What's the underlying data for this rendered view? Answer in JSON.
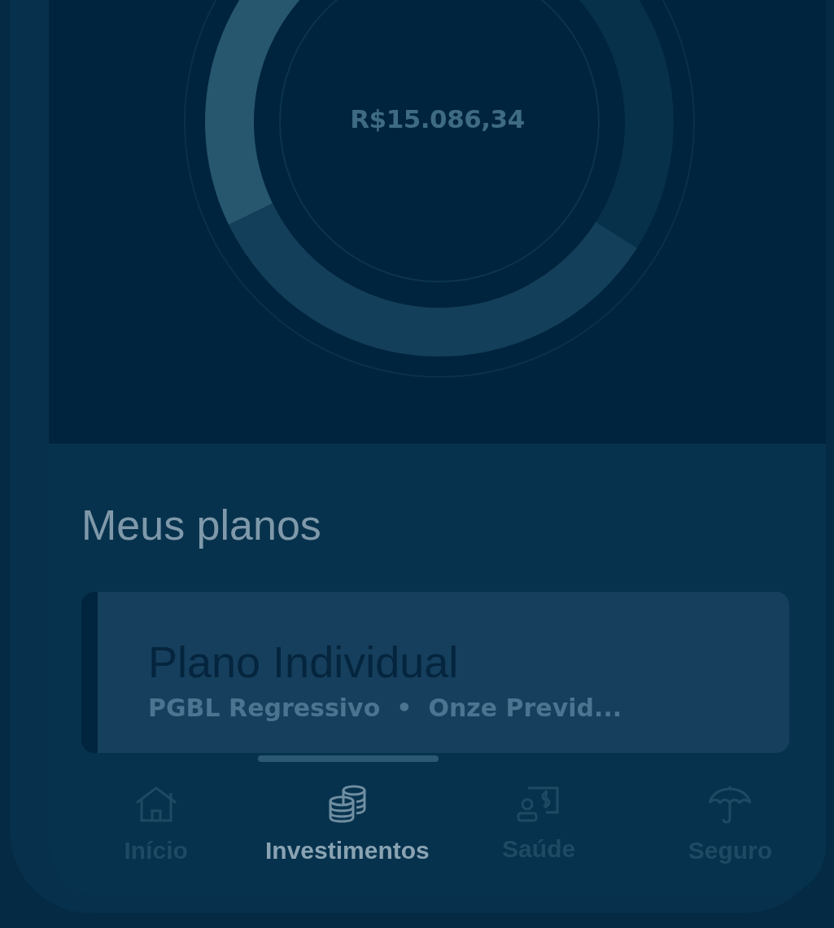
{
  "summary": {
    "total": "R$15.086,34"
  },
  "plans": {
    "title": "Meus planos",
    "card": {
      "name": "Plano Individual",
      "type": "PGBL Regressivo",
      "separator": "•",
      "provider": "Onze Previd..."
    }
  },
  "nav": [
    {
      "kind": "home",
      "label": "Início",
      "selected": false
    },
    {
      "kind": "coins",
      "label": "Investimentos",
      "selected": true
    },
    {
      "kind": "health",
      "label": "Saúde",
      "selected": false
    },
    {
      "kind": "umbrella",
      "label": "Seguro",
      "selected": false
    }
  ]
}
